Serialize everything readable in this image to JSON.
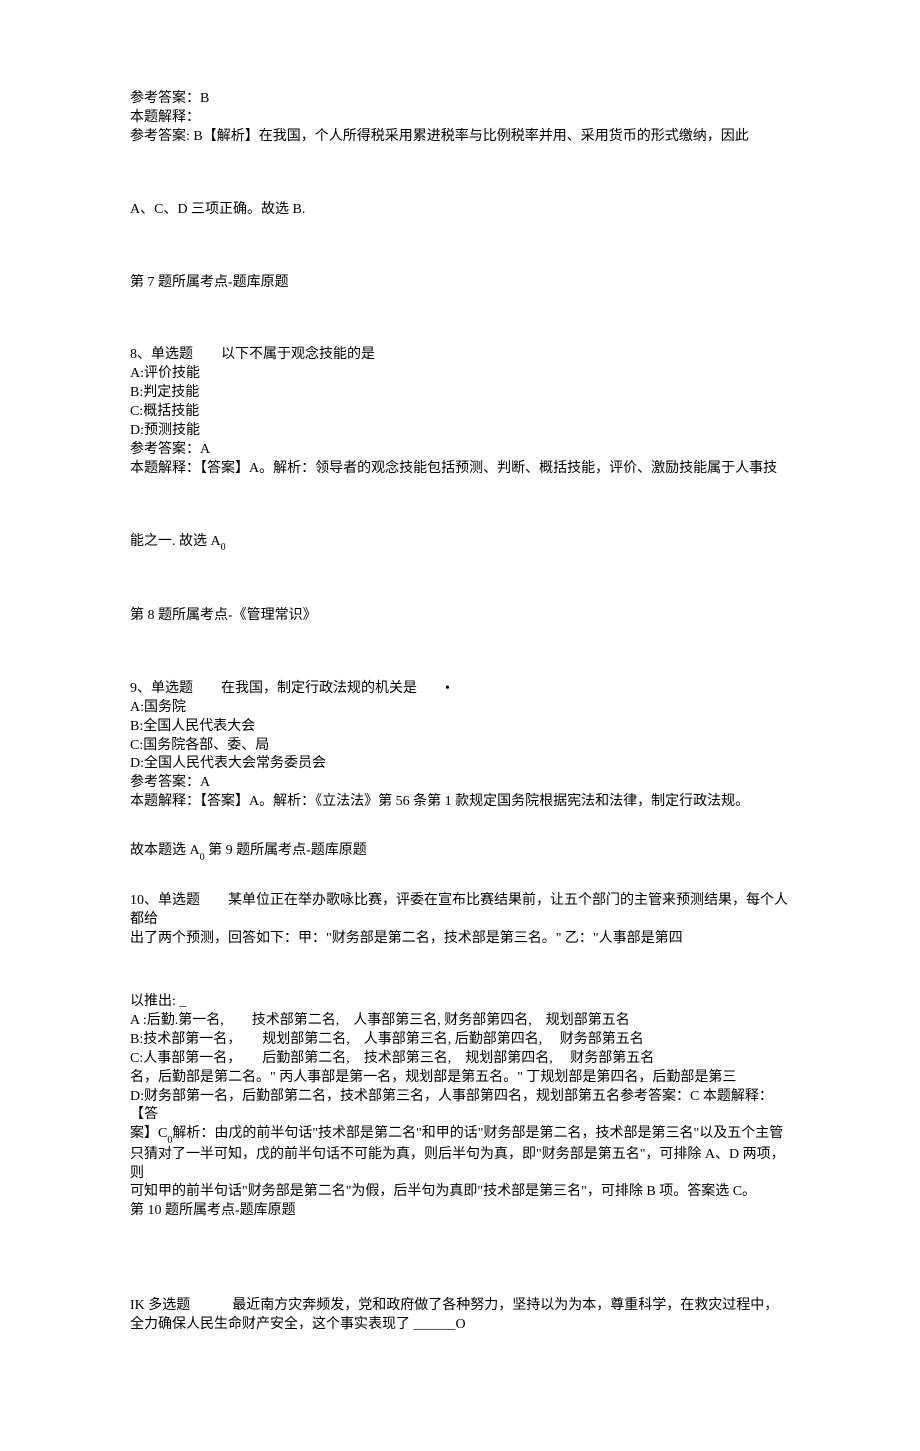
{
  "ans6": {
    "ref": "参考答案：B",
    "title": "本题解释：",
    "explain": "参考答案: B【解析】在我国，个人所得税采用累进税率与比例税率并用、采用货币的形式缴纳，因此",
    "cont": "A、C、D 三项正确。故选 B.",
    "note": "第 7 题所属考点-题库原题"
  },
  "q8": {
    "title": "8、单选题　　以下不属于观念技能的是",
    "a": "A:评价技能",
    "b": "B:判定技能",
    "c": "C:概括技能",
    "d": "D:预测技能",
    "ref": "参考答案：A",
    "explain": "本题解释：【答案】A。解析：领导者的观念技能包括预测、判断、概括技能，评价、激励技能属于人事技",
    "cont_prefix": "能之一. 故选 A",
    "cont_sub": "0",
    "note": "第 8 题所属考点-《管理常识》"
  },
  "q9": {
    "title": "9、单选题　　在我国，制定行政法规的机关是　　•",
    "a": "A:国务院",
    "b": "B:全国人民代表大会",
    "c": "C:国务院各部、委、局",
    "d": "D:全国人民代表大会常务委员会",
    "ref": "参考答案：A",
    "explain": "本题解释：【答案】A。解析：《立法法》第 56 条第 1 款规定国务院根据宪法和法律，制定行政法规。",
    "cont_prefix": "故本题选 A",
    "cont_sub": "0",
    "cont_suffix": " 第 9 题所属考点-题库原题"
  },
  "q10": {
    "title1": "10、单选题　　某单位正在举办歌咏比赛，评委在宣布比赛结果前，让五个部门的主管来预测结果，每个人都给",
    "title2": "出了两个预测，回答如下：甲：\"财务部是第二名，技术部是第三名。\" 乙：\"人事部是第四",
    "lead": "以推出: _",
    "a": "A :后勤.第一名,　　技术部第二名,　人事部第三名, 财务部第四名,　规划部第五名",
    "b": "B:技术部第一名，　　规划部第二名,　人事部第三名, 后勤部第四名,　 财务部第五名",
    "c": "C:人事部第一名，　　后勤部第二名,　技术部第三名,　规划部第四名,　 财务部第五名",
    "extra": "名，后勤部是第二名。\" 丙人事部是第一名，规划部是第五名。\" 丁规划部是第四名，后勤部是第三",
    "d": "D:财务部第一名，后勤部第二名，技术部第三名，人事部第四名，规划部第五名参考答案：C 本题解释：【答",
    "exp_prefix": "案】C",
    "exp_sub": "0",
    "exp_suffix": "解析：由戊的前半句话\"技术部是第二名\"和甲的话\"财务部是第二名，技术部是第三名\"以及五个主管",
    "exp2": "只猜对了一半可知，戊的前半句话不可能为真，则后半句为真，即\"财务部是第五名\"，可排除 A、D 两项，则",
    "exp3": "可知甲的前半句话\"财务部是第二名\"为假，后半句为真即\"技术部是第三名\"，可排除 B 项。答案选 C。",
    "note": "第 10 题所属考点-题库原题"
  },
  "q1k": {
    "title1": "IK 多选题　　　最近南方灾奔频发，党和政府做了各种努力，坚持以为为本，尊重科学，在救灾过程中，",
    "title2": "全力确保人民生命财产安全，这个事实表现了 ______O"
  }
}
